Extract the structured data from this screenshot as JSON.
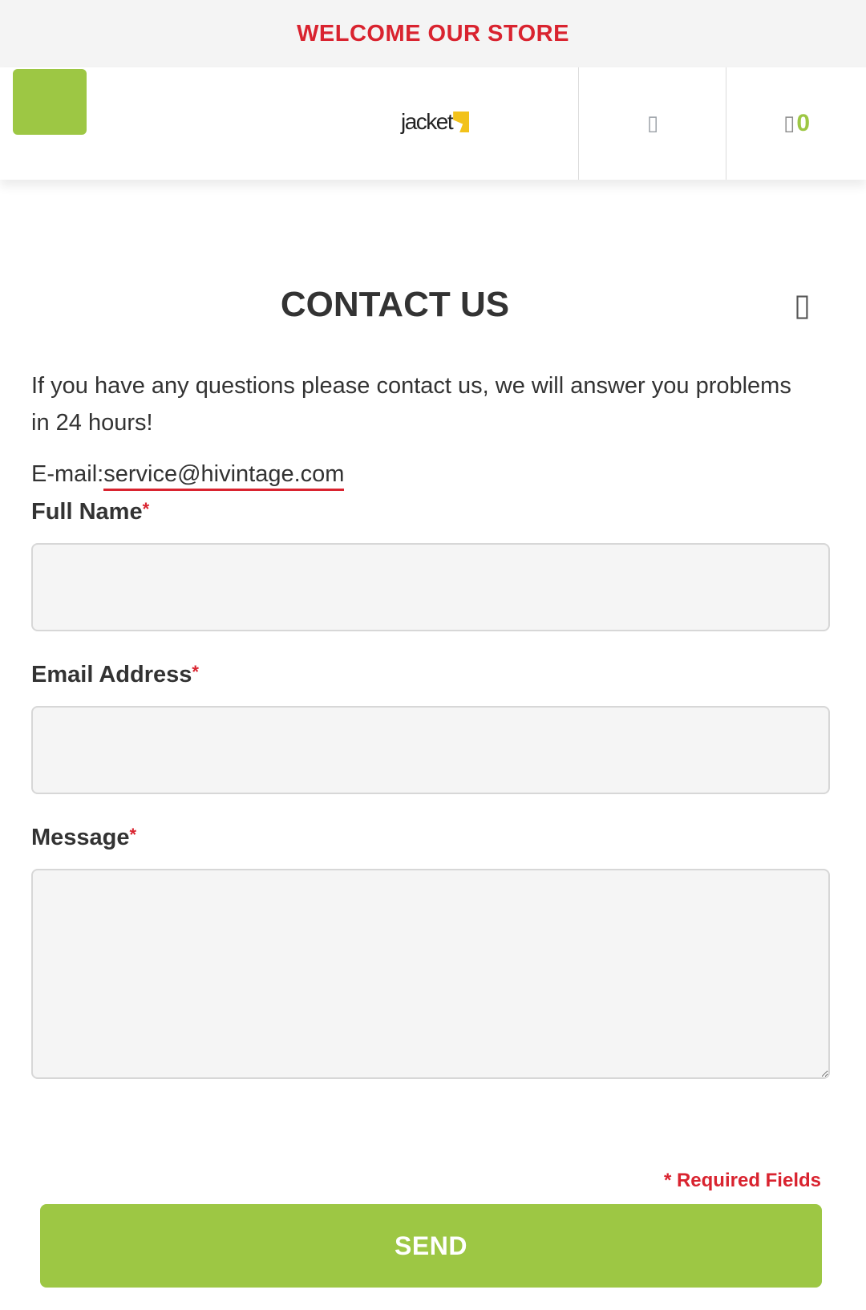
{
  "topbar": {
    "text": "WELCOME OUR STORE"
  },
  "header": {
    "logo_text": "jacket",
    "search_glyph": "▯",
    "cart_glyph": "▯",
    "cart_count": "0"
  },
  "page": {
    "title": "CONTACT US",
    "close_glyph": "▯",
    "intro": "If you have any questions please contact us, we will answer you problems in 24 hours!",
    "email_prefix": "E-mail:",
    "email": "service@hivintage.com"
  },
  "form": {
    "fullname_label": "Full Name",
    "email_label": "Email Address",
    "message_label": "Message",
    "required_mark": "*",
    "required_note": "* Required Fields",
    "send_label": "SEND"
  },
  "colors": {
    "accent_green": "#9dc744",
    "accent_red": "#d9232f",
    "logo_yellow": "#f2c21a"
  },
  "icons": {
    "menu": "menu-icon",
    "search": "search-icon",
    "cart": "cart-icon",
    "close": "close-icon"
  }
}
